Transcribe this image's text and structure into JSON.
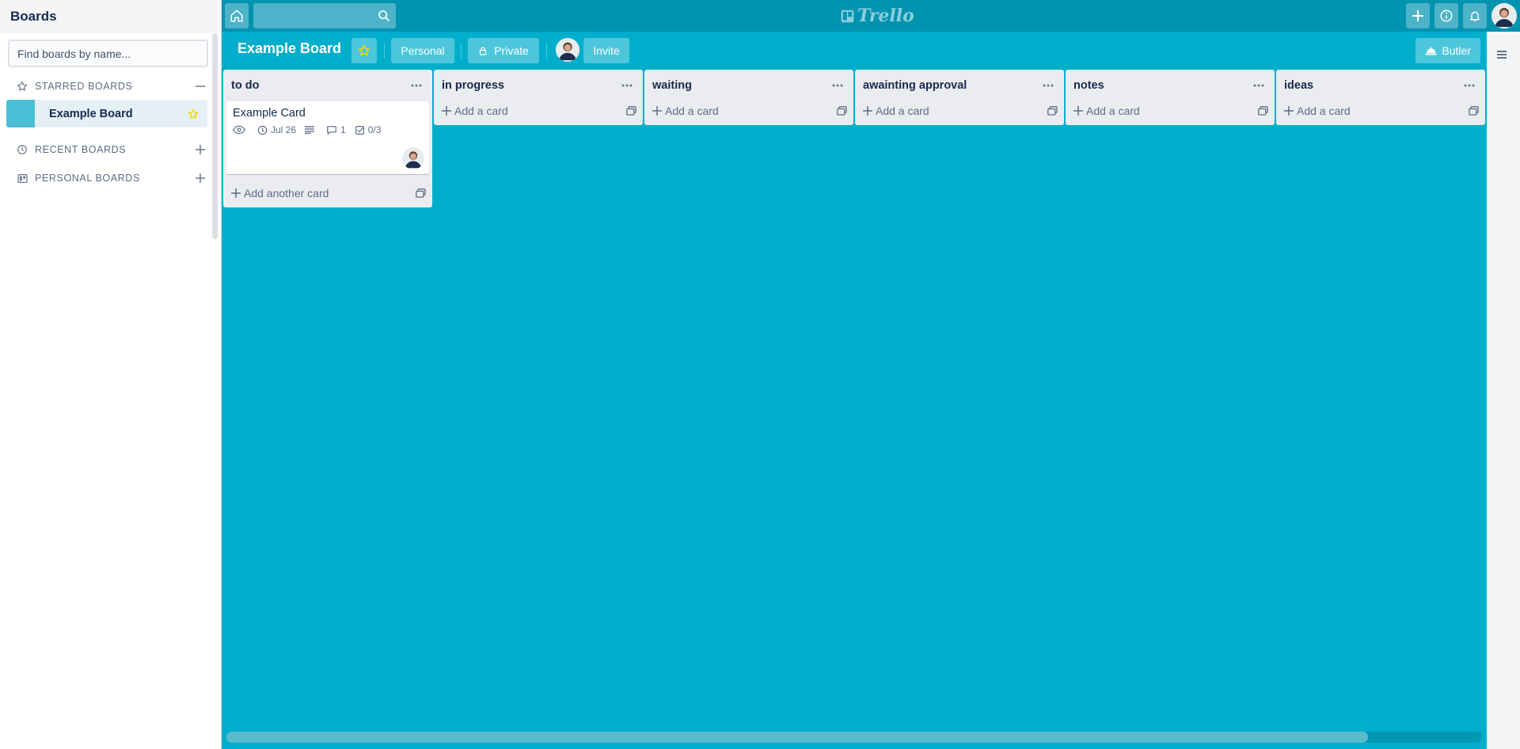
{
  "sidebar": {
    "title": "Boards",
    "search_placeholder": "Find boards by name...",
    "sections": {
      "starred": "STARRED BOARDS",
      "recent": "RECENT BOARDS",
      "personal": "PERSONAL BOARDS"
    },
    "starred_boards": [
      {
        "name": "Example Board",
        "color": "#4bbfd6"
      }
    ]
  },
  "header": {
    "logo_text": "Trello",
    "icons": [
      "home-icon",
      "search-icon",
      "plus-icon",
      "info-icon",
      "bell-icon"
    ]
  },
  "board": {
    "title": "Example Board",
    "team_label": "Personal",
    "visibility_label": "Private",
    "invite_label": "Invite",
    "butler_label": "Butler",
    "background_color": "#00aecc"
  },
  "lists": [
    {
      "title": "to do",
      "add_label": "Add another card",
      "cards": [
        {
          "title": "Example Card",
          "due": "Jul 26",
          "comments": "1",
          "checklist": "0/3"
        }
      ]
    },
    {
      "title": "in progress",
      "add_label": "Add a card",
      "cards": []
    },
    {
      "title": "waiting",
      "add_label": "Add a card",
      "cards": []
    },
    {
      "title": "awainting approval",
      "add_label": "Add a card",
      "cards": []
    },
    {
      "title": "notes",
      "add_label": "Add a card",
      "cards": []
    },
    {
      "title": "ideas",
      "add_label": "Add a card",
      "cards": []
    }
  ]
}
